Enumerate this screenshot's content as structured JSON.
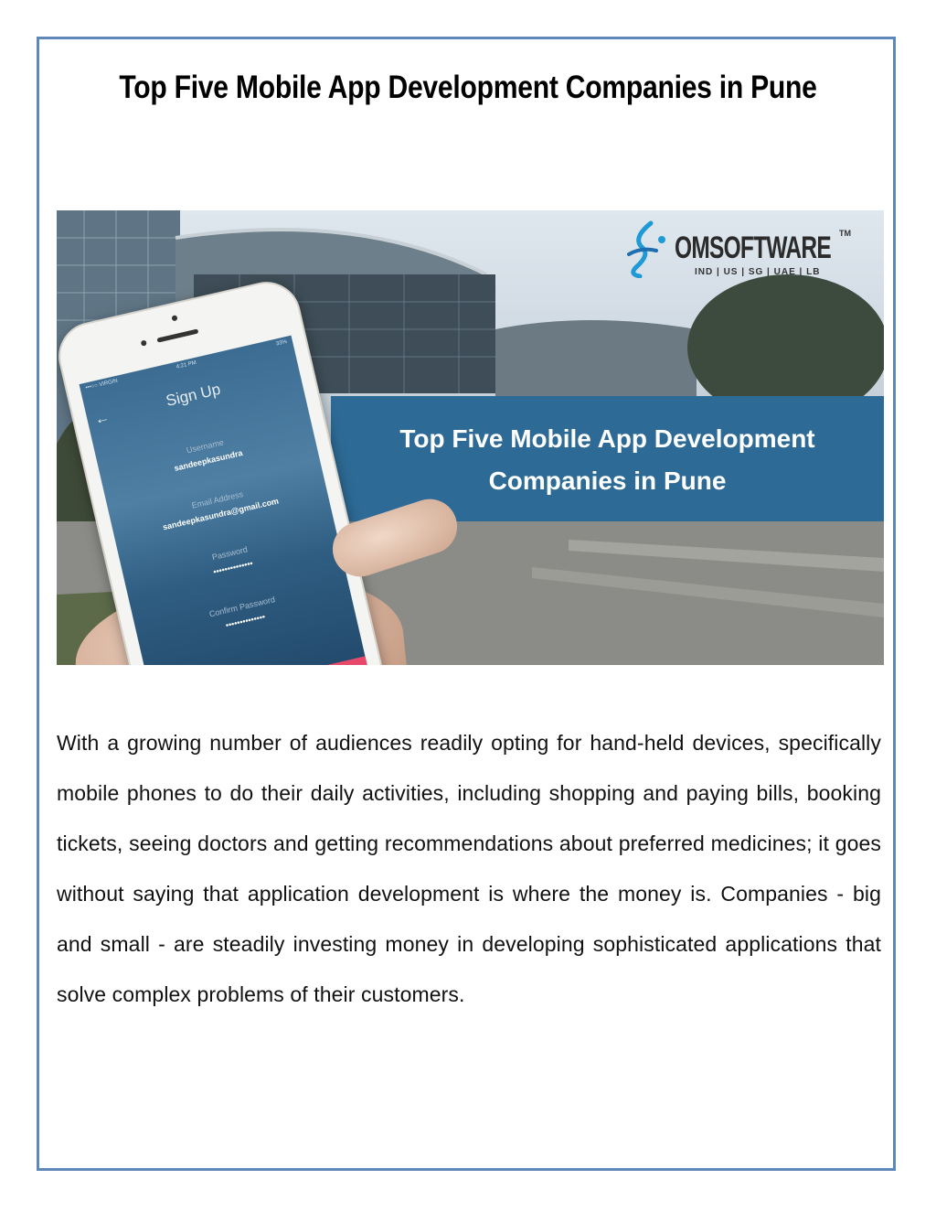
{
  "document": {
    "title": "Top Five Mobile App Development Companies in Pune",
    "hero_image": {
      "logo": {
        "brand": "OMSOFTWARE",
        "trademark": "TM",
        "locations": "IND | US | SG | UAE | LB"
      },
      "banner_text": "Top Five Mobile App Development Companies in Pune",
      "phone_screen": {
        "carrier": "•••○○ VIRGIN",
        "time": "4:21 PM",
        "battery": "33%",
        "title": "Sign Up",
        "fields": [
          {
            "label": "Username",
            "value": "sandeepkasundra"
          },
          {
            "label": "Email Address",
            "value": "sandeepkasundra@gmail.com"
          },
          {
            "label": "Password",
            "value": "••••••••••••••"
          },
          {
            "label": "Confirm Password",
            "value": "••••••••••••••"
          }
        ]
      }
    },
    "paragraph": "With a growing number of audiences readily opting for hand-held devices, specifically mobile phones to do their daily activities, including shopping and paying bills, booking tickets, seeing doctors and getting recommendations about preferred medicines; it goes without saying that application development is where the money is. Companies - big and small - are steadily investing money in developing sophisticated applications that solve complex problems of their customers."
  },
  "colors": {
    "frame_border": "#5f88ba",
    "banner": "#2d6b96",
    "logo_accent": "#1e9ad6",
    "button_accent": "#e8486a"
  }
}
